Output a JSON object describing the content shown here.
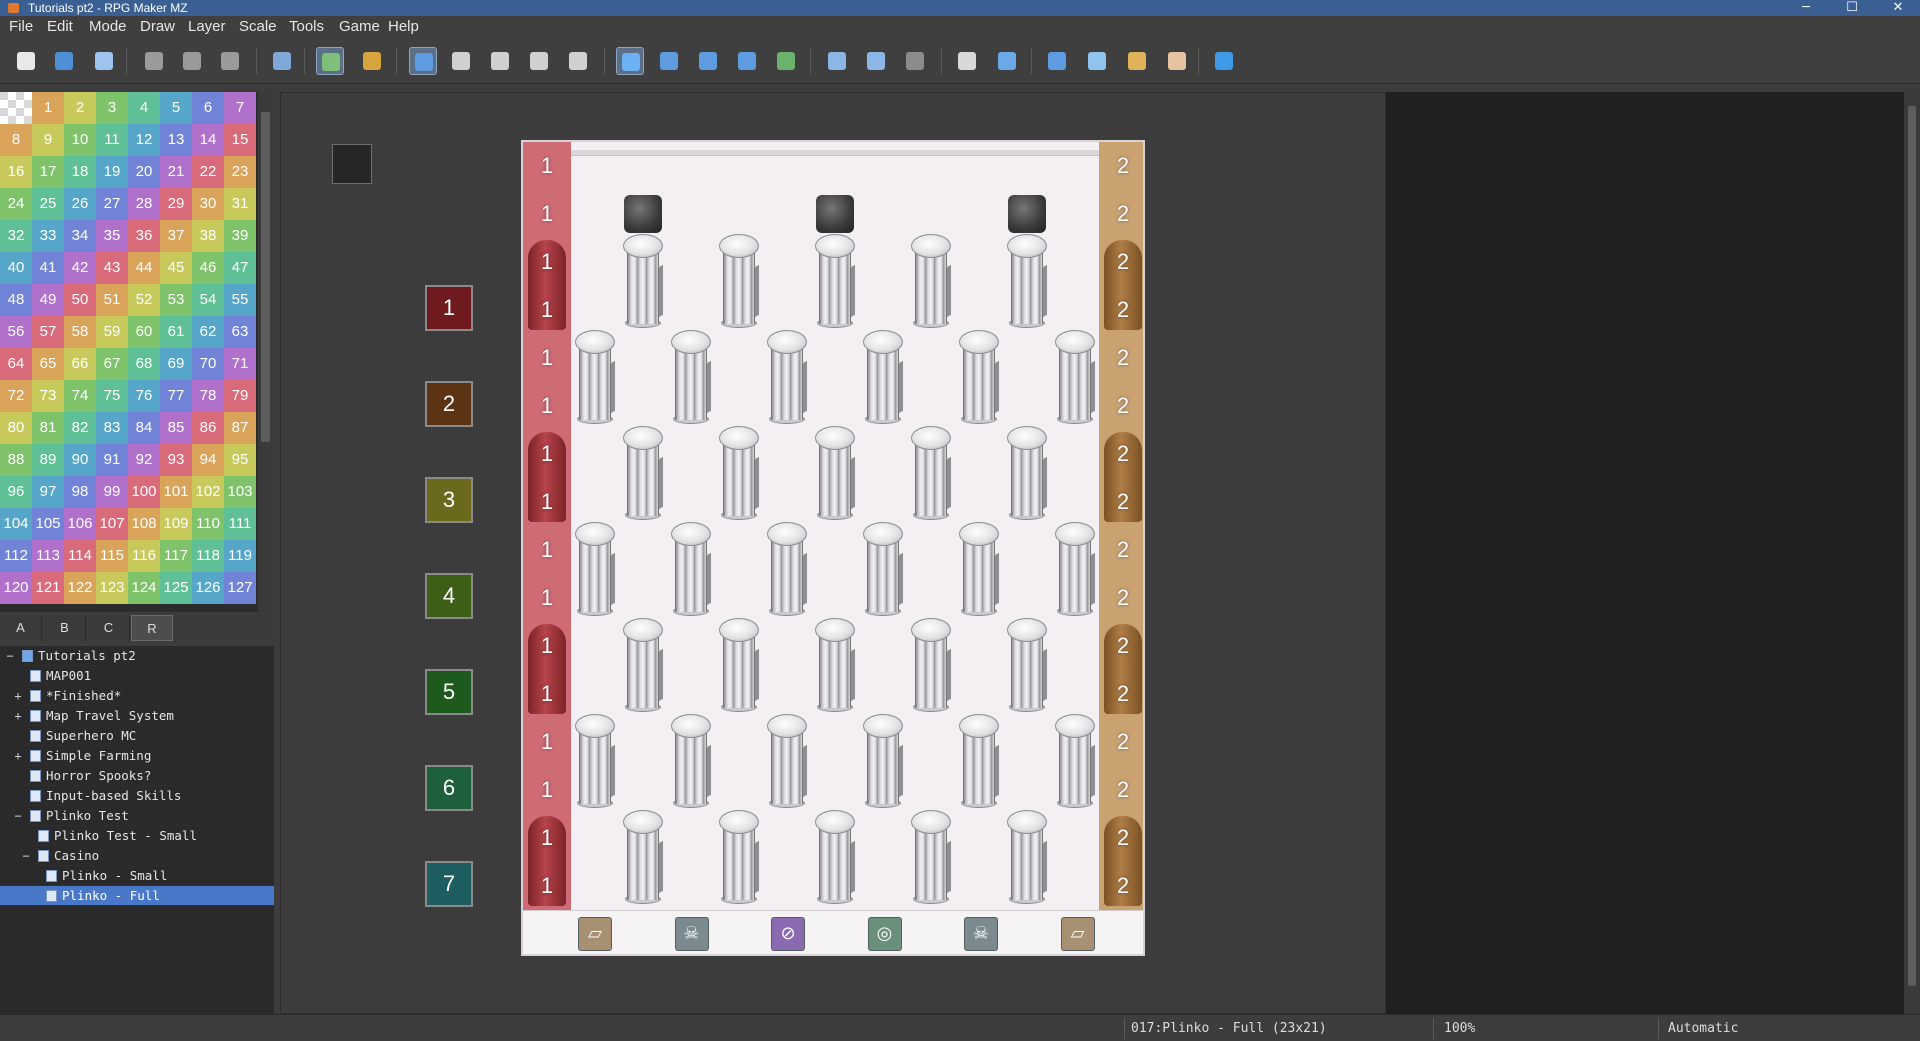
{
  "window": {
    "title": "Tutorials pt2 - RPG Maker MZ",
    "minimize": "─",
    "maximize": "☐",
    "close": "✕"
  },
  "menu": [
    "File",
    "Edit",
    "Mode",
    "Draw",
    "Layer",
    "Scale",
    "Tools",
    "Game",
    "Help"
  ],
  "toolbar": [
    {
      "name": "new-project-icon",
      "color": "#e9e9e9"
    },
    {
      "name": "open-project-icon",
      "color": "#4f8fd6"
    },
    {
      "name": "save-project-icon",
      "color": "#9fc3ef"
    },
    {
      "name": "cut-icon",
      "color": "#9a9a9a"
    },
    {
      "name": "copy-icon",
      "color": "#9a9a9a"
    },
    {
      "name": "paste-icon",
      "color": "#9a9a9a"
    },
    {
      "name": "undo-icon",
      "color": "#7fa8d8"
    },
    {
      "name": "map-mode-icon",
      "color": "#7ec07a",
      "active": true
    },
    {
      "name": "event-mode-icon",
      "color": "#d7a53d"
    },
    {
      "name": "layer-auto-icon",
      "color": "#5f9be0",
      "active": true
    },
    {
      "name": "layer-1-icon",
      "color": "#d0d0d0"
    },
    {
      "name": "layer-2-icon",
      "color": "#d0d0d0"
    },
    {
      "name": "layer-3-icon",
      "color": "#d0d0d0"
    },
    {
      "name": "layer-4-icon",
      "color": "#d0d0d0"
    },
    {
      "name": "pencil-icon",
      "color": "#6db1f5",
      "active": true
    },
    {
      "name": "rectangle-icon",
      "color": "#5f9be0"
    },
    {
      "name": "ellipse-icon",
      "color": "#5f9be0"
    },
    {
      "name": "fill-icon",
      "color": "#5f9be0"
    },
    {
      "name": "shadow-pen-icon",
      "color": "#6bb36a"
    },
    {
      "name": "zoom-in-icon",
      "color": "#8cb6e6"
    },
    {
      "name": "zoom-out-icon",
      "color": "#8cb6e6"
    },
    {
      "name": "actual-size-icon",
      "color": "#8c8c8c"
    },
    {
      "name": "database-icon",
      "color": "#d8d8d8"
    },
    {
      "name": "plugin-manager-icon",
      "color": "#6aa8e6"
    },
    {
      "name": "sound-test-icon",
      "color": "#5f9be0"
    },
    {
      "name": "event-searcher-icon",
      "color": "#8fc4ef"
    },
    {
      "name": "resource-manager-icon",
      "color": "#e0b35a"
    },
    {
      "name": "character-generator-icon",
      "color": "#e6c4a0"
    },
    {
      "name": "playtest-icon",
      "color": "#3f9ae8"
    }
  ],
  "palette": {
    "colors": [
      "#d96a7a",
      "#d9a35a",
      "#c7c95a",
      "#7ec26a",
      "#5fbf96",
      "#55a6c8",
      "#7183d6",
      "#b070cc"
    ],
    "first": 1,
    "last": 127
  },
  "tabs": [
    "A",
    "B",
    "C",
    "R"
  ],
  "active_tab": 3,
  "tree": [
    {
      "label": "Tutorials pt2",
      "depth": 0,
      "exp": "−",
      "root": true
    },
    {
      "label": "MAP001",
      "depth": 1,
      "exp": ""
    },
    {
      "label": "*Finished*",
      "depth": 1,
      "exp": "+"
    },
    {
      "label": "Map Travel System",
      "depth": 1,
      "exp": "+"
    },
    {
      "label": "Superhero MC",
      "depth": 1,
      "exp": ""
    },
    {
      "label": "Simple Farming",
      "depth": 1,
      "exp": "+"
    },
    {
      "label": "Horror Spooks?",
      "depth": 1,
      "exp": ""
    },
    {
      "label": "Input-based Skills",
      "depth": 1,
      "exp": ""
    },
    {
      "label": "Plinko Test",
      "depth": 1,
      "exp": "−"
    },
    {
      "label": "Plinko Test - Small",
      "depth": 2,
      "exp": ""
    },
    {
      "label": "Casino",
      "depth": 2,
      "exp": "−"
    },
    {
      "label": "Plinko - Small",
      "depth": 3,
      "exp": ""
    },
    {
      "label": "Plinko - Full",
      "depth": 3,
      "exp": "",
      "selected": true
    }
  ],
  "legend": [
    {
      "label": "1",
      "color": "#6e1a1f"
    },
    {
      "label": "2",
      "color": "#5c3414"
    },
    {
      "label": "3",
      "color": "#6b6a1c"
    },
    {
      "label": "4",
      "color": "#3d5e17"
    },
    {
      "label": "5",
      "color": "#1e5a1e"
    },
    {
      "label": "6",
      "color": "#1e5f3c"
    },
    {
      "label": "7",
      "color": "#1e5e60"
    }
  ],
  "board": {
    "left_label": "1",
    "right_label": "2",
    "rows": 16,
    "prizes": [
      "▱",
      "☠",
      "⊘",
      "◎",
      "☠",
      "▱"
    ]
  },
  "status": {
    "map": "017:Plinko - Full (23x21)",
    "zoom": "100%",
    "mode": "Automatic"
  }
}
